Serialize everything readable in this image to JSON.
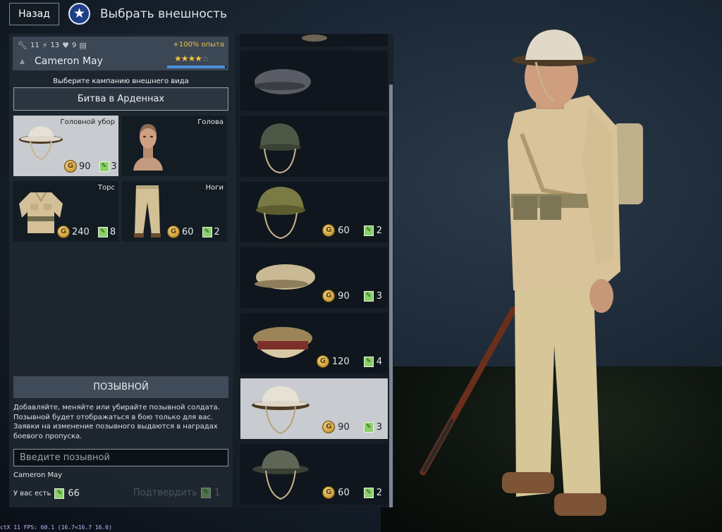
{
  "topbar": {
    "back_label": "Назад",
    "star_glyph": "★",
    "title": "Выбрать внешность"
  },
  "soldier_card": {
    "stats": [
      "11",
      "13",
      "9"
    ],
    "exp_bonus": "+100% опыта",
    "name": "Cameron May",
    "rating": 4,
    "rating_max": 5,
    "rating_progress": 0.98
  },
  "campaign": {
    "label": "Выберите кампанию внешнего вида",
    "selected": "Битва в Арденнах"
  },
  "slots": [
    {
      "label": "Головной убор",
      "gold": "90",
      "tickets": "3",
      "selected": true,
      "icon": "helmet-icon"
    },
    {
      "label": "Голова",
      "gold": "",
      "tickets": "",
      "selected": false,
      "icon": "head-icon"
    },
    {
      "label": "Торс",
      "gold": "240",
      "tickets": "8",
      "selected": false,
      "icon": "tunic-icon"
    },
    {
      "label": "Ноги",
      "gold": "60",
      "tickets": "2",
      "selected": false,
      "icon": "trousers-icon"
    }
  ],
  "callsign": {
    "header": "ПОЗЫВНОЙ",
    "description": "Добавляйте, меняйте или убирайте позывной солдата. Позывной будет отображаться в бою только для вас. Заявки на изменение позывного выдаются в наградах боевого пропуска.",
    "placeholder": "Введите позывной",
    "current": "Cameron May",
    "balance_label": "У вас есть",
    "balance_value": "66",
    "confirm_label": "Подтвердить",
    "confirm_cost": "1"
  },
  "headgear_list": [
    {
      "name": "beret-grey",
      "gold": "",
      "tickets": "",
      "selected": false
    },
    {
      "name": "helmet-green",
      "gold": "",
      "tickets": "",
      "selected": false
    },
    {
      "name": "helmet-olive",
      "gold": "60",
      "tickets": "2",
      "selected": false
    },
    {
      "name": "beret-khaki",
      "gold": "90",
      "tickets": "3",
      "selected": false
    },
    {
      "name": "peaked-cap",
      "gold": "120",
      "tickets": "4",
      "selected": false
    },
    {
      "name": "brodie-helmet-light",
      "gold": "90",
      "tickets": "3",
      "selected": true
    },
    {
      "name": "brodie-helmet-green",
      "gold": "60",
      "tickets": "2",
      "selected": false
    }
  ],
  "icons": {
    "coin": "G",
    "ticket": "✎"
  },
  "colors": {
    "accent_blue": "#4d91dc",
    "gold_text": "#e7c14b",
    "selected_bg": "#c8ccd0",
    "ticket_green": "#8cd06a"
  },
  "fps_text": "ctX 11 FPS: 60.1 (16.7<16.7 16.6)"
}
